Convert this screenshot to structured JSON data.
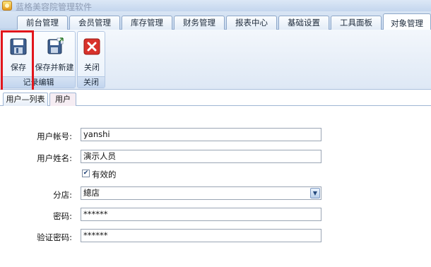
{
  "window": {
    "title": "蓝格美容院管理软件"
  },
  "menu": {
    "tabs": [
      {
        "label": "前台管理"
      },
      {
        "label": "会员管理"
      },
      {
        "label": "库存管理"
      },
      {
        "label": "财务管理"
      },
      {
        "label": "报表中心"
      },
      {
        "label": "基础设置"
      },
      {
        "label": "工具面板"
      },
      {
        "label": "对象管理",
        "active": true
      }
    ]
  },
  "ribbon": {
    "groups": [
      {
        "label": "记录编辑",
        "buttons": [
          {
            "label": "保存",
            "icon": "floppy-disk-icon"
          },
          {
            "label": "保存并新建",
            "icon": "save-and-new-icon"
          }
        ]
      },
      {
        "label": "关闭",
        "buttons": [
          {
            "label": "关闭",
            "icon": "close-icon"
          }
        ]
      }
    ],
    "highlight_color": "#e2161c"
  },
  "doc_tabs": [
    {
      "label": "用户—列表"
    },
    {
      "label": "用户",
      "active": true
    }
  ],
  "form": {
    "account_label": "用户帐号:",
    "account_value": "yanshi",
    "name_label": "用户姓名:",
    "name_value": "演示人员",
    "valid_label": "有效的",
    "valid_checked": true,
    "check_mark": "✔",
    "branch_label": "分店:",
    "branch_value": "總店",
    "branch_arrow": "▼",
    "password_label": "密码:",
    "password_value": "******",
    "confirm_label": "验证密码:",
    "confirm_value": "******"
  }
}
